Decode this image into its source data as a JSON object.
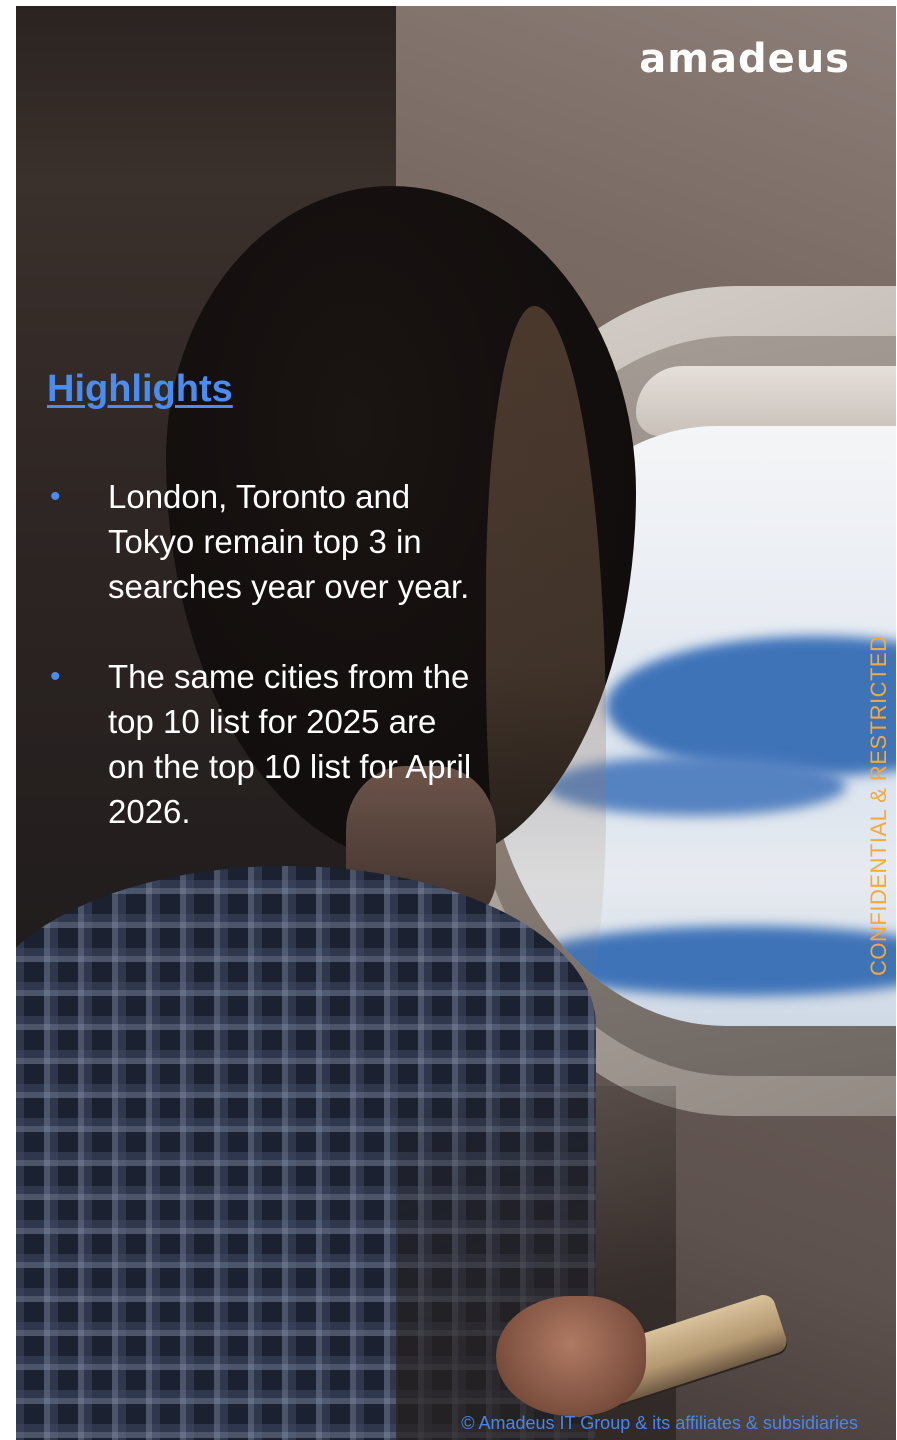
{
  "brand": {
    "logo_text": "amadeus"
  },
  "highlights": {
    "title": "Highlights",
    "items": [
      "London, Toronto and Tokyo  remain top 3 in searches year over year.",
      "The same cities from the top 10 list for 2025  are on the top 10 list for April 2026."
    ]
  },
  "classification": "CONFIDENTIAL & RESTRICTED",
  "footer": {
    "copyright": "© Amadeus IT Group & its affiliates & subsidiaries"
  },
  "colors": {
    "accent_blue": "#4a8cf0",
    "classification_orange": "#f3a93c",
    "text_white": "#ffffff"
  },
  "icons": {
    "bullet": "bullet-dot-icon"
  }
}
